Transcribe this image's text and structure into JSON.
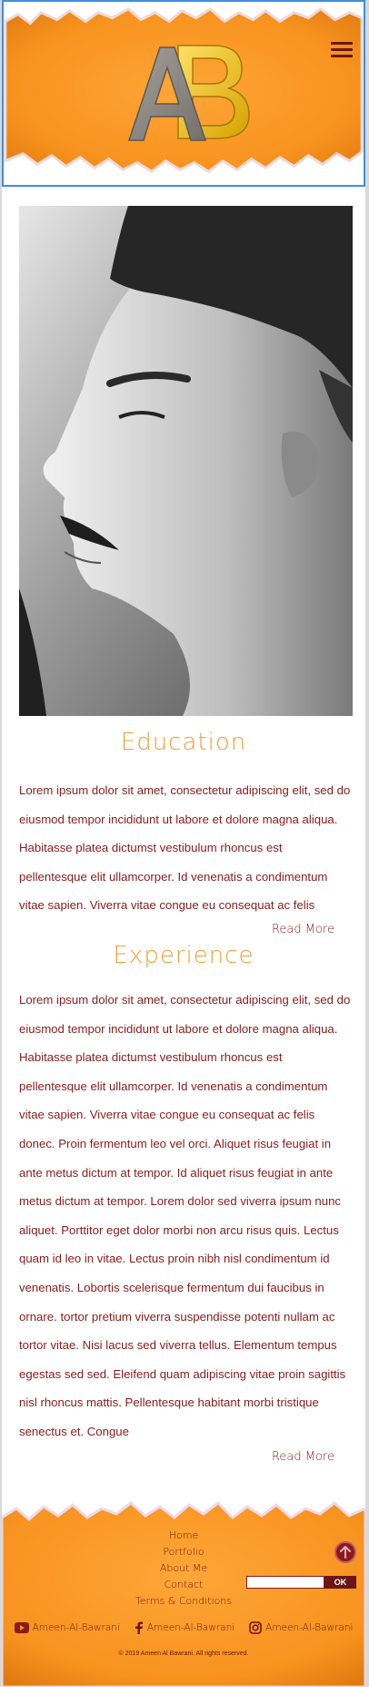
{
  "header": {
    "logo_text": "AB",
    "menu_icon": "hamburger-menu-icon",
    "accent_color": "#f7931e"
  },
  "sections": [
    {
      "title": "Education",
      "text": "Lorem ipsum dolor sit amet, consectetur adipiscing elit, sed do eiusmod tempor incididunt ut labore et dolore magna aliqua. Habitasse platea dictumst vestibulum rhoncus est pellentesque elit ullamcorper. Id venenatis a condimentum vitae sapien. Viverra vitae congue eu consequat ac felis",
      "read_more": "Read More"
    },
    {
      "title": "Experience",
      "text": "Lorem ipsum dolor sit amet, consectetur adipiscing elit, sed do eiusmod tempor incididunt ut labore et dolore magna aliqua. Habitasse platea dictumst vestibulum rhoncus est pellentesque elit ullamcorper. Id venenatis a condimentum vitae sapien. Viverra vitae congue eu consequat ac felis donec. Proin fermentum leo vel orci. Aliquet risus feugiat in ante metus dictum at tempor. Id aliquet risus feugiat in ante metus dictum at tempor. Lorem dolor sed viverra ipsum nunc aliquet. Porttitor eget dolor morbi non arcu risus quis. Lectus quam id leo in vitae. Lectus proin nibh nisl condimentum id venenatis. Lobortis scelerisque fermentum dui faucibus in ornare. tortor pretium viverra suspendisse potenti nullam ac tortor vitae. Nisi lacus sed viverra tellus. Elementum tempus egestas sed sed. Eleifend quam adipiscing vitae proin sagittis nisl rhoncus mattis. Pellentesque habitant morbi tristique senectus et. Congue",
      "read_more": "Read More"
    }
  ],
  "footer": {
    "links": [
      "Home",
      "Portfolio",
      "About Me",
      "Contact",
      "Terms & Conditions"
    ],
    "subscribe_button": "OK",
    "subscribe_placeholder": "",
    "socials": [
      {
        "icon": "youtube-icon",
        "label": "Ameen-Al-Bawrani"
      },
      {
        "icon": "facebook-icon",
        "label": "Ameen-Al-Bawrani"
      },
      {
        "icon": "instagram-icon",
        "label": "Ameen-Al-Bawrani"
      }
    ],
    "copyright": "© 2019 Ameen Al Bawrani. All rights reserved."
  }
}
